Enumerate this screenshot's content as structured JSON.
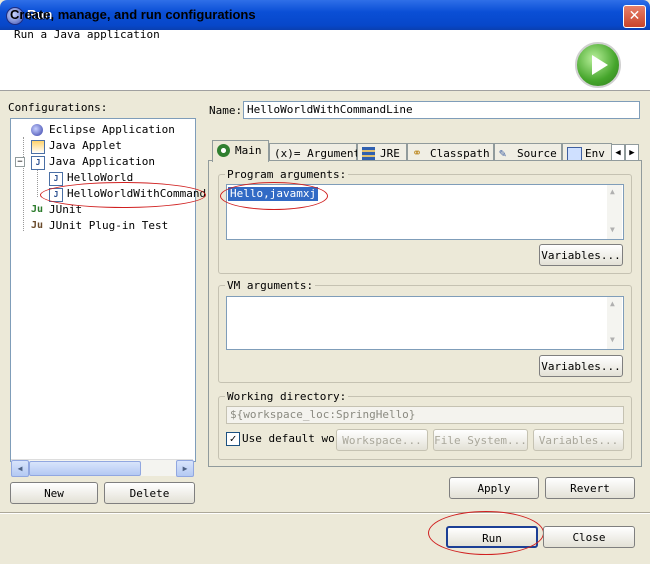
{
  "window": {
    "title": "Run"
  },
  "header": {
    "title": "Create, manage, and run configurations",
    "subtitle": "Run a Java application"
  },
  "left": {
    "label": "Configurations:",
    "tree": [
      {
        "label": "Eclipse Application",
        "icon": "eclipse-app-icon"
      },
      {
        "label": "Java Applet",
        "icon": "applet-icon"
      },
      {
        "label": "Java Application",
        "icon": "java-app-icon",
        "expanded": true
      },
      {
        "label": "HelloWorld",
        "icon": "java-config-icon"
      },
      {
        "label": "HelloWorldWithCommand",
        "icon": "java-config-icon",
        "selected": true
      },
      {
        "label": "JUnit",
        "icon": "junit-icon"
      },
      {
        "label": "JUnit Plug-in Test",
        "icon": "junit-plugin-icon"
      }
    ],
    "new_label": "New",
    "delete_label": "Delete"
  },
  "name": {
    "label": "Name:",
    "value": "HelloWorldWithCommandLine"
  },
  "tabs": [
    {
      "label": "Main",
      "icon": "main-icon"
    },
    {
      "label": "Arguments",
      "icon": "arguments-icon",
      "prefix": "(x)="
    },
    {
      "label": "JRE",
      "icon": "jre-icon"
    },
    {
      "label": "Classpath",
      "icon": "classpath-icon"
    },
    {
      "label": "Source",
      "icon": "source-icon"
    },
    {
      "label": "Env",
      "icon": "environment-icon"
    }
  ],
  "program_args": {
    "label": "Program arguments:",
    "value": "Hello,javamxj",
    "variables_label": "Variables..."
  },
  "vm_args": {
    "label": "VM arguments:",
    "value": "",
    "variables_label": "Variables..."
  },
  "working_dir": {
    "label": "Working directory:",
    "value": "${workspace_loc:SpringHello}",
    "use_default_label": "Use default wor",
    "use_default_checked": true,
    "workspace_label": "Workspace...",
    "filesystem_label": "File System...",
    "variables_label": "Variables..."
  },
  "actions": {
    "apply_label": "Apply",
    "revert_label": "Revert",
    "run_label": "Run",
    "close_label": "Close"
  },
  "colors": {
    "titlebar": "#0a4fd6",
    "selection": "#316ac5",
    "annotation": "#d02020"
  }
}
